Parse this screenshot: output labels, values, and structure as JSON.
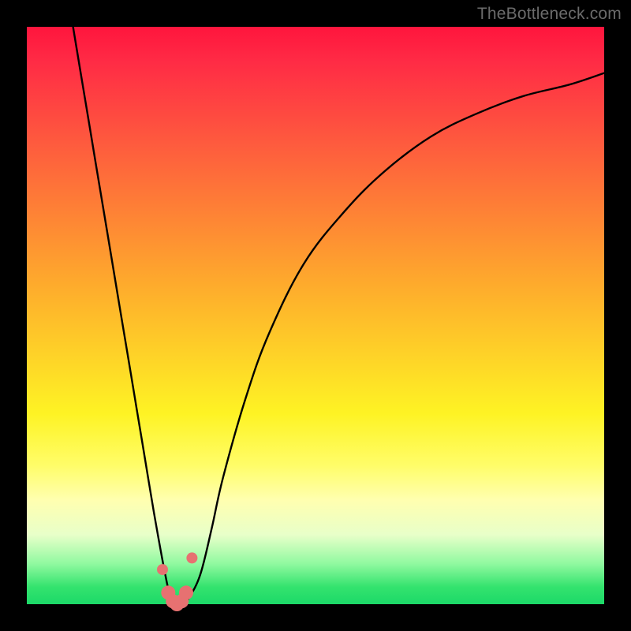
{
  "watermark": "TheBottleneck.com",
  "colors": {
    "frame": "#000000",
    "curve_stroke": "#000000",
    "markers_fill": "#e77171",
    "markers_stroke": "#c24848",
    "gradient_top": "#ff153d",
    "gradient_bottom": "#1cd968"
  },
  "chart_data": {
    "type": "line",
    "title": "",
    "xlabel": "",
    "ylabel": "",
    "xlim": [
      0,
      100
    ],
    "ylim": [
      0,
      100
    ],
    "series": [
      {
        "name": "bottleneck-curve",
        "x": [
          8,
          10,
          12,
          14,
          16,
          18,
          20,
          22,
          24,
          25,
          26,
          27,
          28,
          30,
          32,
          34,
          38,
          42,
          48,
          55,
          62,
          70,
          78,
          86,
          94,
          100
        ],
        "y": [
          100,
          88,
          76,
          64,
          52,
          40,
          28,
          16,
          5,
          1,
          0,
          0,
          1,
          5,
          13,
          22,
          36,
          47,
          59,
          68,
          75,
          81,
          85,
          88,
          90,
          92
        ]
      }
    ],
    "markers": {
      "name": "valley-highlight",
      "x": [
        23.5,
        24.5,
        25.3,
        26.0,
        26.8,
        27.6,
        28.6
      ],
      "y": [
        6,
        2,
        0.5,
        0,
        0.5,
        2,
        8
      ],
      "size": [
        7,
        9,
        9,
        9,
        9,
        9,
        7
      ]
    }
  }
}
